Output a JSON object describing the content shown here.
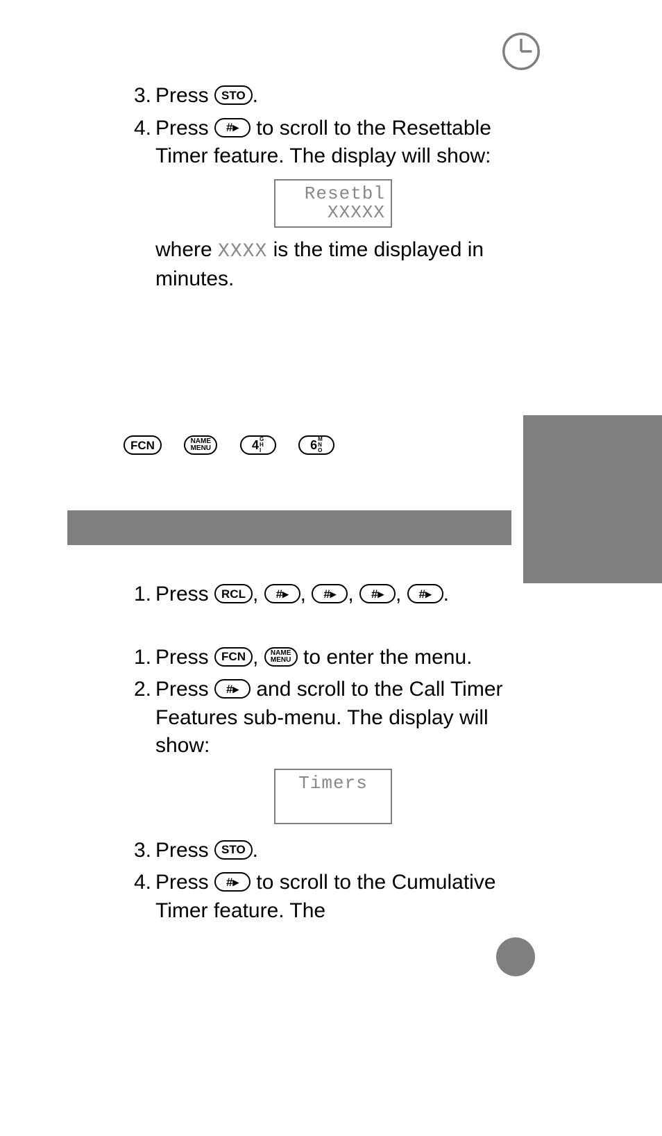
{
  "keys": {
    "sto": "STO",
    "rcl": "RCL",
    "fcn": "FCN",
    "hash": "#▸",
    "name_top": "NAME",
    "name_bot": "MENU",
    "k4": "4",
    "k4_sub_a": "G",
    "k4_sub_b": "H",
    "k4_sub_c": "I",
    "k6": "6",
    "k6_sub_a": "M",
    "k6_sub_b": "N",
    "k6_sub_c": "O"
  },
  "s1": {
    "n3": "3.",
    "t3a": "Press ",
    "t3b": ".",
    "n4": "4.",
    "t4a": "Press ",
    "t4b": " to scroll to the Resettable Timer feature. The display will show:",
    "lcd1": "Resetbl",
    "lcd2": "XXXXX",
    "t4c_a": "where ",
    "t4c_ph": "XXXX",
    "t4c_b": " is the time displayed in minutes."
  },
  "s2": {
    "n1a": "1.",
    "t1a_a": "Press ",
    "sep": ", ",
    "t1a_end": ".",
    "n1b": "1.",
    "t1b_a": "Press ",
    "t1b_b": " to enter the menu.",
    "n2": "2.",
    "t2a": "Press ",
    "t2b": " and scroll to the Call Timer Features sub-menu. The display will show:",
    "lcd": "Timers",
    "n3": "3.",
    "t3a": "Press ",
    "t3b": ".",
    "n4": "4.",
    "t4a": "Press ",
    "t4b": " to scroll to the Cumulative Timer feature. The"
  }
}
